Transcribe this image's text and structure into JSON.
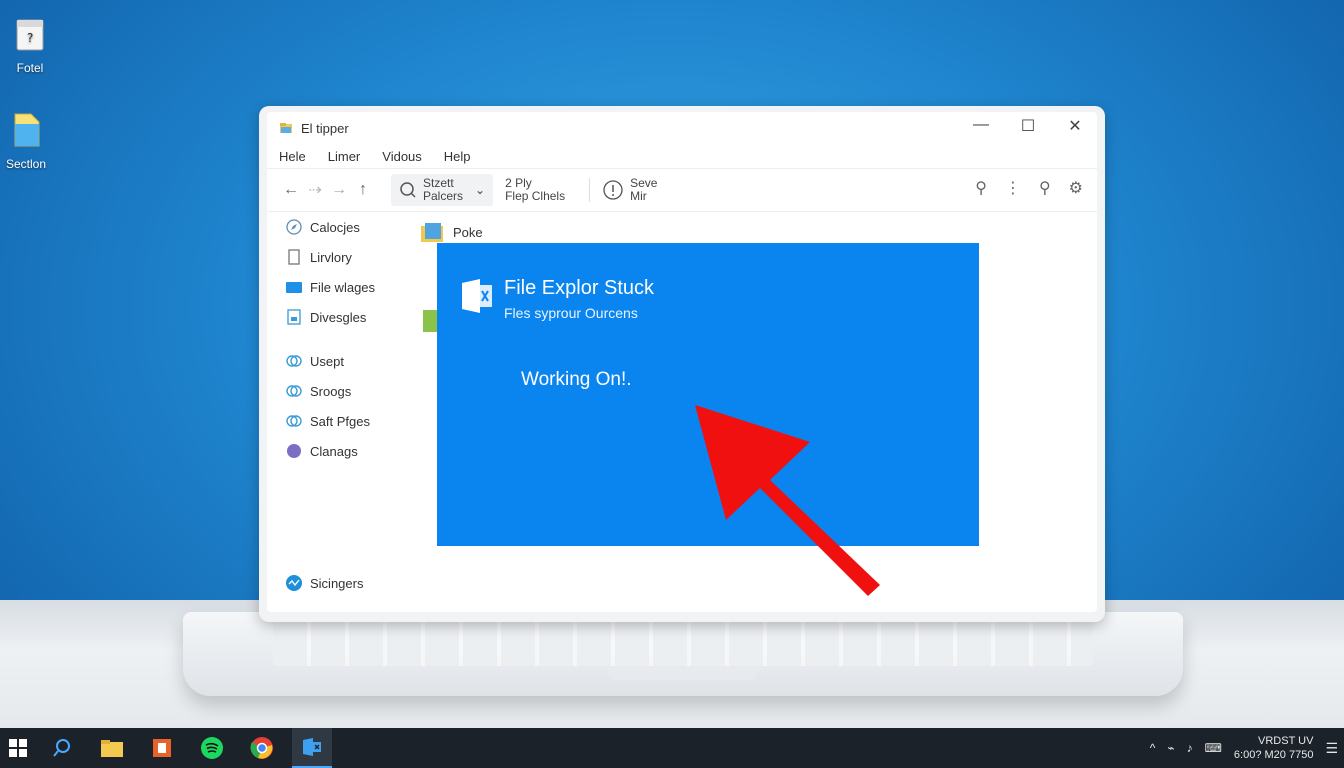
{
  "desktop": {
    "icons": [
      {
        "label": "Fotel"
      },
      {
        "label": "Sectlon"
      }
    ]
  },
  "window": {
    "title": "El tipper",
    "controls": {
      "minimize": "—",
      "maximize": "☐",
      "close": "✕"
    },
    "menu": [
      "Hele",
      "Limer",
      "Vidous",
      "Help"
    ],
    "toolbar": {
      "group1_line1": "Stzett",
      "group1_line2": "Palcers",
      "group2_line1": "2 Ply",
      "group2_line2": "Flep Clhels",
      "group3_line1": "Seve",
      "group3_line2": "Mir"
    },
    "sidebar": [
      {
        "label": "Calocjes",
        "icon": "compass-icon"
      },
      {
        "label": "Lirvlory",
        "icon": "document-icon"
      },
      {
        "label": "File wlages",
        "icon": "folder-icon"
      },
      {
        "label": "Divesgles",
        "icon": "image-icon"
      },
      {
        "label": "Usept",
        "icon": "link-icon"
      },
      {
        "label": "Sroogs",
        "icon": "link-icon"
      },
      {
        "label": "Saft Pfges",
        "icon": "link-icon"
      },
      {
        "label": "Clanags",
        "icon": "globe-icon"
      }
    ],
    "sidebar_footer": "Sicingers",
    "folder": "Poke"
  },
  "overlay": {
    "title": "File Explor Stuck",
    "subtitle": "Fles syprour Ourcens",
    "status": "Working On!."
  },
  "taskbar": {
    "tray_chevron": "^",
    "clock_line1": "VRDST UV",
    "clock_line2": "6:00? M20 7750"
  },
  "colors": {
    "overlay_blue": "#0a84ee",
    "arrow_red": "#f01010",
    "taskbar": "#1b2229"
  }
}
